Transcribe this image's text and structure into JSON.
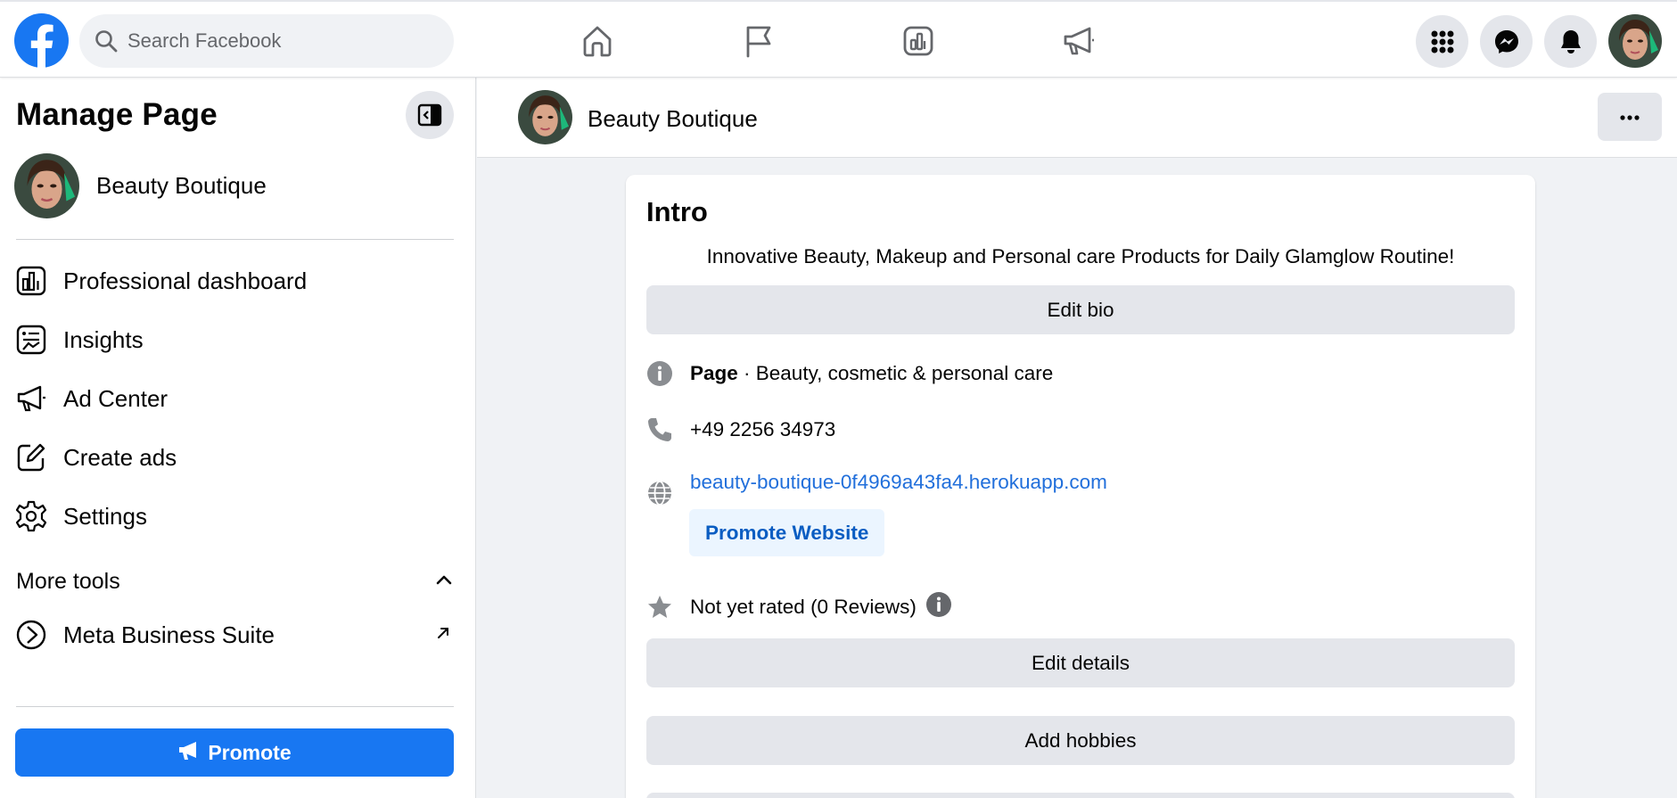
{
  "topbar": {
    "search_placeholder": "Search Facebook",
    "nav": [
      "home-icon",
      "flag-icon",
      "dashboard-icon",
      "megaphone-icon"
    ],
    "right": [
      "menu-grid-icon",
      "messenger-icon",
      "notifications-icon"
    ]
  },
  "sidebar": {
    "title": "Manage Page",
    "page_name": "Beauty Boutique",
    "items": [
      {
        "label": "Professional dashboard",
        "icon": "dashboard-icon"
      },
      {
        "label": "Insights",
        "icon": "insights-icon"
      },
      {
        "label": "Ad Center",
        "icon": "megaphone-icon"
      },
      {
        "label": "Create ads",
        "icon": "edit-icon"
      },
      {
        "label": "Settings",
        "icon": "gear-icon"
      }
    ],
    "more_tools_label": "More tools",
    "meta_business_label": "Meta Business Suite",
    "promote_label": "Promote"
  },
  "header": {
    "page_name": "Beauty Boutique"
  },
  "intro": {
    "title": "Intro",
    "bio": "Innovative Beauty, Makeup and Personal care Products for Daily Glamglow Routine!",
    "edit_bio_label": "Edit bio",
    "category_bold": "Page",
    "category_rest": " · Beauty, cosmetic & personal care",
    "phone": "+49 2256 34973",
    "website": "beauty-boutique-0f4969a43fa4.herokuapp.com",
    "promote_website_label": "Promote Website",
    "rating": "Not yet rated (0 Reviews)",
    "edit_details_label": "Edit details",
    "add_hobbies_label": "Add hobbies"
  },
  "colors": {
    "brand_blue": "#1877f2",
    "link_blue": "#216fdb",
    "button_grey": "#e4e6eb",
    "page_bg": "#f0f2f5"
  }
}
